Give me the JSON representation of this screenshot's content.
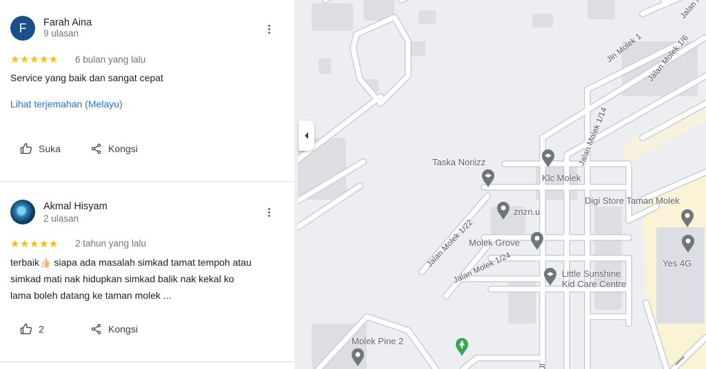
{
  "reviews": [
    {
      "avatar_letter": "F",
      "name": "Farah Aina",
      "review_count": "9 ulasan",
      "stars": "★★★★★",
      "time": "6 bulan yang lalu",
      "text": "Service yang baik dan sangat cepat",
      "translate_link": "Lihat terjemahan (Melayu)",
      "like_label": "Suka",
      "share_label": "Kongsi"
    },
    {
      "name": "Akmal Hisyam",
      "review_count": "2 ulasan",
      "stars": "★★★★★",
      "time": "2 tahun yang lalu",
      "text_line_1": "terbaik👍🏻 siapa ada masalah simkad tamat tempoh atau",
      "text_line_2": "simkad mati nak hidupkan simkad balik nak kekal ko",
      "text_line_3": "lama boleh datang ke taman molek ...",
      "like_count": "2",
      "share_label": "Kongsi"
    }
  ],
  "map": {
    "pois": {
      "taska": "Taska Noriizz",
      "klc": "Klc Molek",
      "digi": "Digi Store Taman Molek",
      "znzn": "znzn.u",
      "grove": "Molek Grove",
      "yes4g": "Yes 4G",
      "little_sunshine_1": "Little Sunshine",
      "little_sunshine_2": "Kid Care Centre",
      "pine": "Molek Pine 2"
    },
    "streets": {
      "jln_molek_1": "Jln Molek 1",
      "jalan_molek_1_6": "Jalan Molek 1/6",
      "jalan_molek_top": "Jalan M",
      "jalan_molek_1_14": "Jalan Molek 1/14",
      "jalan_molek_1_22": "Jalan Molek 1/22",
      "jalan_molek_1_24": "Jalan Molek 1/24",
      "jl_bottom": "Jl"
    },
    "colors": {
      "background": "#eceef1",
      "road": "#ffffff",
      "building": "#dcdee3",
      "pin": "#70757a",
      "park_pin": "#34a853",
      "residential": "#fbf3d5"
    }
  }
}
